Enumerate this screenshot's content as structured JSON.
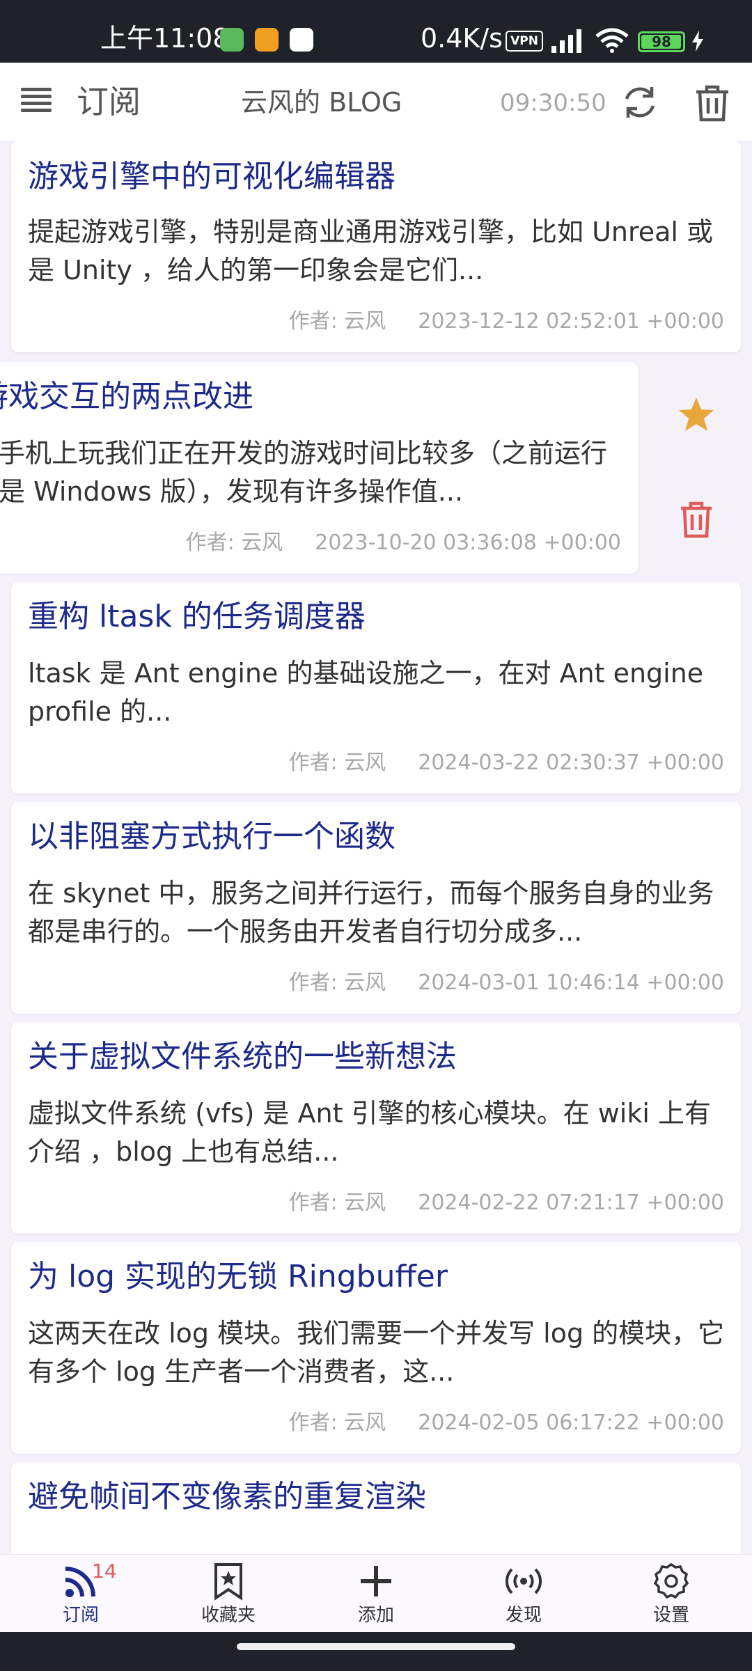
{
  "status_bar": {
    "time": "上午11:08",
    "net_speed": "0.4K/s",
    "vpn": "VPN",
    "battery": "98",
    "battery_level": 0.98
  },
  "app_bar": {
    "title": "订阅",
    "feed_name": "云风的 BLOG",
    "time": "09:30:50",
    "icons": [
      "menu-icon",
      "refresh-icon",
      "trash-icon"
    ]
  },
  "articles": [
    {
      "title": "游戏引擎中的可视化编辑器",
      "summary": "提起游戏引擎，特别是商业通用游戏引擎，比如 Unreal 或是 Unity ，给人的第一印象会是它们...",
      "author": "作者: 云风",
      "date": "2023-12-12 02:52:01 +00:00"
    },
    {
      "title": "游戏交互的两点改进",
      "summary": "在手机上玩我们正在开发的游戏时间比较多（之前运行的是 Windows 版），发现有许多操作值...",
      "author": "作者: 云风",
      "date": "2023-10-20 03:36:08 +00:00"
    },
    {
      "title": "重构 ltask 的任务调度器",
      "summary": "ltask 是 Ant engine 的基础设施之一，在对 Ant engine profile 的...",
      "author": "作者: 云风",
      "date": "2024-03-22 02:30:37 +00:00"
    },
    {
      "title": "以非阻塞方式执行一个函数",
      "summary": "在 skynet 中，服务之间并行运行，而每个服务自身的业务都是串行的。一个服务由开发者自行切分成多...",
      "author": "作者: 云风",
      "date": "2024-03-01 10:46:14 +00:00"
    },
    {
      "title": "关于虚拟文件系统的一些新想法",
      "summary": "虚拟文件系统 (vfs) 是 Ant 引擎的核心模块。在 wiki 上有介绍 ，blog 上也有总结...",
      "author": "作者: 云风",
      "date": "2024-02-22 07:21:17 +00:00"
    },
    {
      "title": "为 log 实现的无锁 Ringbuffer",
      "summary": "这两天在改 log 模块。我们需要一个并发写 log 的模块，它有多个 log 生产者一个消费者，这...",
      "author": "作者: 云风",
      "date": "2024-02-05 06:17:22 +00:00"
    },
    {
      "title": "避免帧间不变像素的重复渲染"
    }
  ],
  "swipe_actions": {
    "icons": [
      "star-icon",
      "delete-icon"
    ],
    "star_color": "#e8a73a",
    "delete_color": "#e05a5a"
  },
  "bottom_nav": {
    "items": [
      {
        "label": "订阅",
        "icon": "rss-icon",
        "badge": "14"
      },
      {
        "label": "收藏夹",
        "icon": "bookmark-icon"
      },
      {
        "label": "添加",
        "icon": "plus-icon"
      },
      {
        "label": "发现",
        "icon": "broadcast-icon"
      },
      {
        "label": "设置",
        "icon": "gear-icon"
      }
    ],
    "active_color": "#1e2a8a"
  }
}
